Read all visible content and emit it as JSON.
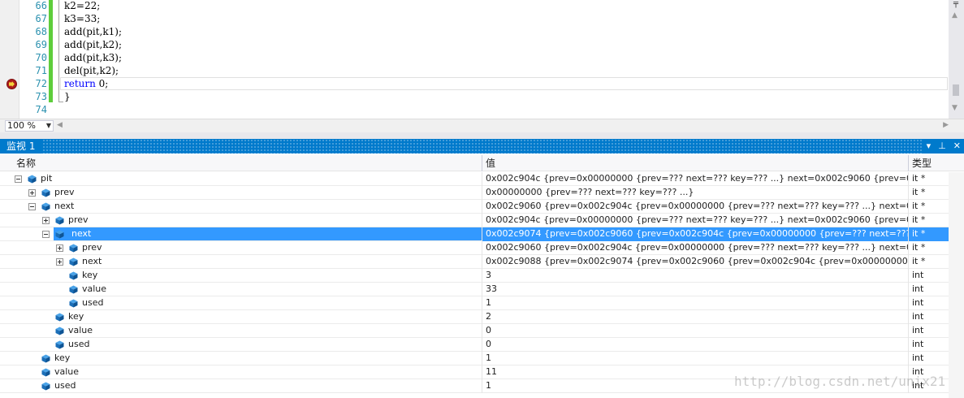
{
  "editor": {
    "line_numbers": [
      "66",
      "67",
      "68",
      "69",
      "70",
      "71",
      "72",
      "73",
      "74"
    ],
    "code_lines": [
      "k2=22;",
      "k3=33;",
      "add(pit,k1);",
      "add(pit,k2);",
      "add(pit,k3);",
      "del(pit,k2);",
      "return 0;",
      "}",
      ""
    ],
    "breakpoint_line": "72",
    "zoom": "100 %"
  },
  "watch": {
    "title": "监视 1",
    "buttons": {
      "dropdown": "▾",
      "pin": "⊥",
      "close": "✕"
    },
    "columns": {
      "name": "名称",
      "value": "值",
      "type": "类型"
    },
    "rows": [
      {
        "name": "pit",
        "value": "0x002c904c {prev=0x00000000 {prev=??? next=??? key=??? ...} next=0x002c9060 {prev=0x002c904c {p",
        "type": "it *"
      },
      {
        "name": "prev",
        "value": "0x00000000 {prev=??? next=??? key=??? ...}",
        "type": "it *"
      },
      {
        "name": "next",
        "value": "0x002c9060 {prev=0x002c904c {prev=0x00000000 {prev=??? next=??? key=??? ...} next=0x002c9060 {p",
        "type": "it *"
      },
      {
        "name": "prev",
        "value": "0x002c904c {prev=0x00000000 {prev=??? next=??? key=??? ...} next=0x002c9060 {prev=0x002c904c {p",
        "type": "it *"
      },
      {
        "name": "next",
        "value": "0x002c9074 {prev=0x002c9060 {prev=0x002c904c {prev=0x00000000 {prev=??? next=??? key=??? ...} n",
        "type": "it *"
      },
      {
        "name": "prev",
        "value": "0x002c9060 {prev=0x002c904c {prev=0x00000000 {prev=??? next=??? key=??? ...} next=0x002c9060 {p",
        "type": "it *"
      },
      {
        "name": "next",
        "value": "0x002c9088 {prev=0x002c9074 {prev=0x002c9060 {prev=0x002c904c {prev=0x00000000 {...} next=0x00",
        "type": "it *"
      },
      {
        "name": "key",
        "value": "3",
        "type": "int"
      },
      {
        "name": "value",
        "value": "33",
        "type": "int"
      },
      {
        "name": "used",
        "value": "1",
        "type": "int"
      },
      {
        "name": "key",
        "value": "2",
        "type": "int"
      },
      {
        "name": "value",
        "value": "0",
        "type": "int"
      },
      {
        "name": "used",
        "value": "0",
        "type": "int"
      },
      {
        "name": "key",
        "value": "1",
        "type": "int"
      },
      {
        "name": "value",
        "value": "11",
        "type": "int"
      },
      {
        "name": "used",
        "value": "1",
        "type": "int"
      }
    ]
  },
  "watermark": "http://blog.csdn.net/unix21",
  "colors": {
    "accent": "#007acc",
    "selection": "#3399ff",
    "line_number": "#2b91af",
    "keyword": "#0000ff",
    "change_bar": "#5ecd3c"
  }
}
